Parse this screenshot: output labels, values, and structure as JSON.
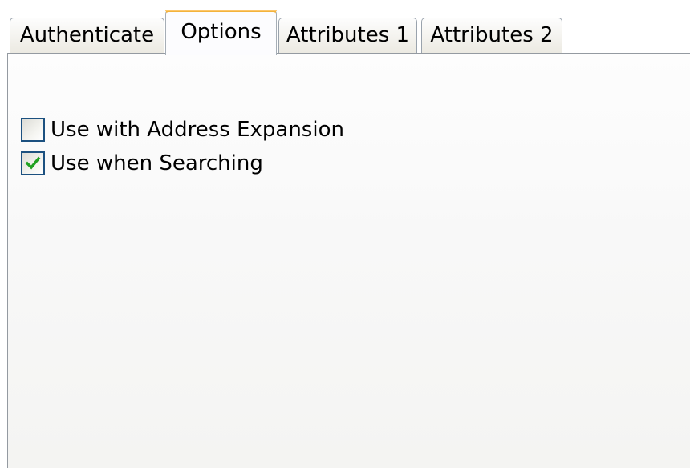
{
  "tabs": [
    {
      "label": "Authenticate",
      "active": false
    },
    {
      "label": "Options",
      "active": true
    },
    {
      "label": "Attributes 1",
      "active": false
    },
    {
      "label": "Attributes 2",
      "active": false
    }
  ],
  "options": [
    {
      "label": "Use with Address Expansion",
      "checked": false
    },
    {
      "label": "Use when Searching",
      "checked": true
    }
  ],
  "colors": {
    "active_tab_accent": "#f3b33c",
    "checkbox_border": "#1c5180",
    "checkmark": "#21a121"
  },
  "icons": {
    "checkmark": "check-icon"
  }
}
